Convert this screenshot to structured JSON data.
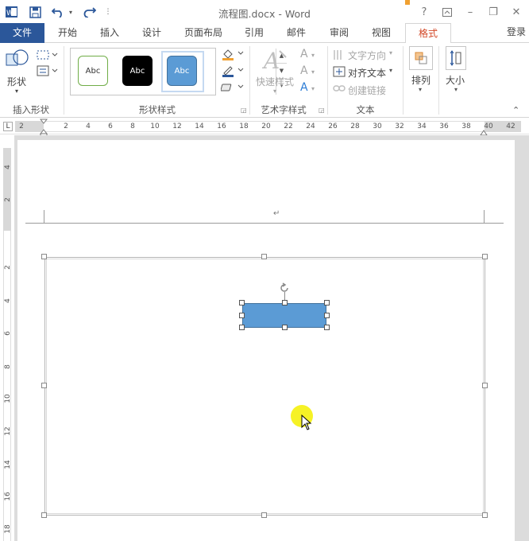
{
  "window": {
    "title": "流程图.docx - Word",
    "help": "?",
    "minimize": "–",
    "restore": "❐",
    "close": "✕"
  },
  "tabs": {
    "file": "文件",
    "home": "开始",
    "insert": "插入",
    "design": "设计",
    "layout": "页面布局",
    "references": "引用",
    "mailings": "邮件",
    "review": "审阅",
    "view": "视图",
    "format": "格式",
    "login": "登录"
  },
  "ribbon": {
    "insert_shapes": {
      "shapes_label": "形状",
      "group_label": "插入形状"
    },
    "shape_styles": {
      "group_label": "形状样式",
      "presets": [
        {
          "text": "Abc",
          "fill": "#ffffff",
          "border": "#70ad47",
          "color": "#333333"
        },
        {
          "text": "Abc",
          "fill": "#000000",
          "border": "#000000",
          "color": "#ffffff"
        },
        {
          "text": "Abc",
          "fill": "#5b9bd5",
          "border": "#41719c",
          "color": "#ffffff"
        }
      ]
    },
    "wordart": {
      "quick_styles": "快速样式",
      "group_label": "艺术字样式"
    },
    "text": {
      "direction": "文字方向",
      "align": "对齐文本",
      "link": "创建链接",
      "group_label": "文本"
    },
    "arrange": {
      "label": "排列"
    },
    "size": {
      "label": "大小"
    }
  },
  "ruler": {
    "h_marks": [
      "2",
      "2",
      "4",
      "6",
      "8",
      "10",
      "12",
      "14",
      "16",
      "18",
      "20",
      "22",
      "24",
      "26",
      "28",
      "30",
      "32",
      "34",
      "36",
      "38",
      "40",
      "42"
    ],
    "v_marks": [
      "4",
      "2",
      "2",
      "4",
      "6",
      "8",
      "10",
      "12",
      "14",
      "16",
      "18"
    ]
  },
  "document": {
    "paragraph_mark": "↵",
    "shape_fill": "#5b9bd5"
  },
  "colors": {
    "accent": "#2b579a",
    "active_tab": "#d24726",
    "cursor_highlight": "#f5f000"
  }
}
